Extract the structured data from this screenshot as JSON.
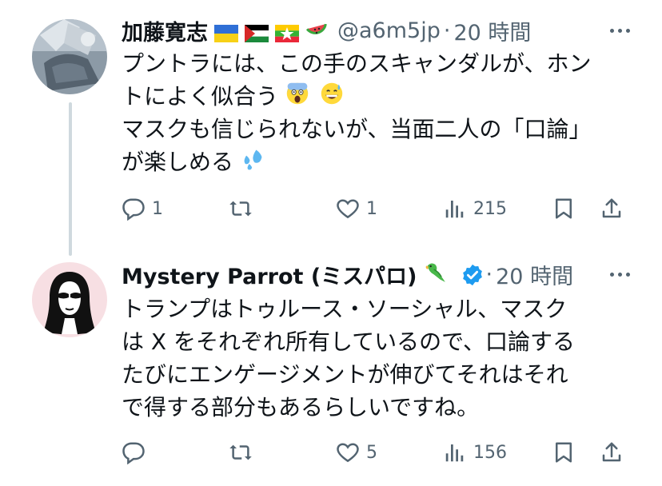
{
  "tweets": [
    {
      "display_name": "加藤寛志",
      "handle": "@a6m5jp",
      "separator": "·",
      "time": "20 時間",
      "lines": [
        "プントラには、この手のスキャンダルが、ホン",
        "トによく似合う",
        "マスクも信じられないが、当面二人の「口論」",
        "が楽しめる"
      ],
      "line_emoji": [
        "",
        "face-screaming-in-fear-icon, grinning-face-with-sweat-icon",
        "",
        "sweat-droplets-icon"
      ],
      "name_icons": [
        "ukraine-flag-icon",
        "palestine-flag-icon",
        "myanmar-flag-icon",
        "watermelon-icon"
      ],
      "stats": {
        "replies": "1",
        "retweets": "",
        "likes": "1",
        "views": "215"
      }
    },
    {
      "display_name": "Mystery Parrot (ミスパロ)",
      "handle": "",
      "separator": "·",
      "time": "20 時間",
      "lines": [
        "トランプはトゥルース・ソーシャル、マスク",
        "は X をそれぞれ所有しているので、口論する",
        "たびにエンゲージメントが伸びてそれはそれ",
        "で得する部分もあるらしいですね。"
      ],
      "name_icons": [
        "parrot-icon",
        "verified-badge-icon"
      ],
      "stats": {
        "replies": "",
        "retweets": "",
        "likes": "5",
        "views": "156"
      }
    }
  ],
  "colors": {
    "text": "#0f1419",
    "secondary": "#536471",
    "verified": "#1d9bf0",
    "thread_line": "#cfd9de"
  }
}
